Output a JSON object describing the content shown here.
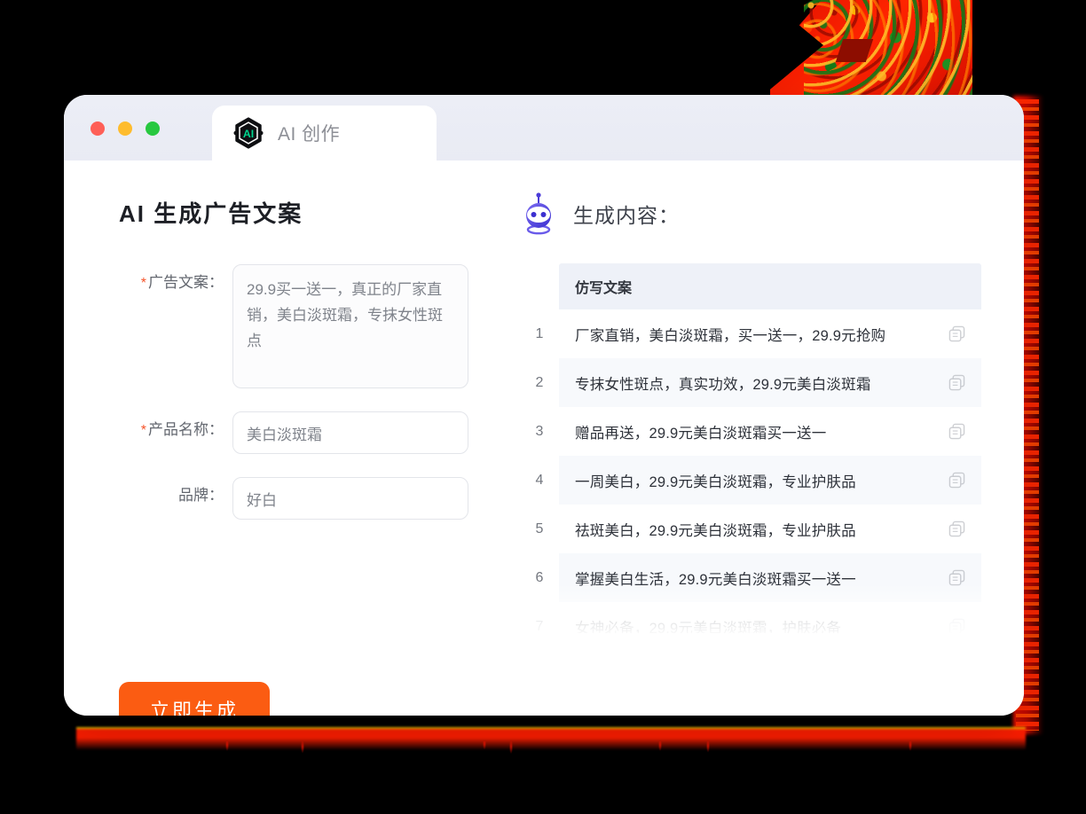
{
  "window": {
    "traffic_lights": [
      "close",
      "minimize",
      "maximize"
    ],
    "tab": {
      "label": "AI 创作",
      "logo_text": "AI",
      "logo_color": "#00d68f"
    }
  },
  "left_pane": {
    "title": "AI 生成广告文案",
    "fields": [
      {
        "label": "广告文案：",
        "required": true,
        "type": "textarea",
        "value": "29.9买一送一，真正的厂家直销，美白淡斑霜，专抹女性斑点"
      },
      {
        "label": "产品名称：",
        "required": true,
        "type": "input",
        "value": "美白淡斑霜"
      },
      {
        "label": "品牌：",
        "required": false,
        "type": "input",
        "value": "好白"
      }
    ],
    "submit_button": {
      "label": "立即生成",
      "color": "#fb5c12"
    }
  },
  "right_pane": {
    "title": "生成内容：",
    "robot_icon": "robot-head-icon",
    "table": {
      "column_header": "仿写文案",
      "rows": [
        {
          "index": "1",
          "text": "厂家直销，美白淡斑霜，买一送一，29.9元抢购",
          "action_icon": "copy-icon"
        },
        {
          "index": "2",
          "text": "专抹女性斑点，真实功效，29.9元美白淡斑霜",
          "action_icon": "copy-icon"
        },
        {
          "index": "3",
          "text": "赠品再送，29.9元美白淡斑霜买一送一",
          "action_icon": "copy-icon"
        },
        {
          "index": "4",
          "text": "一周美白，29.9元美白淡斑霜，专业护肤品",
          "action_icon": "copy-icon"
        },
        {
          "index": "5",
          "text": "祛斑美白，29.9元美白淡斑霜，专业护肤品",
          "action_icon": "copy-icon"
        },
        {
          "index": "6",
          "text": "掌握美白生活，29.9元美白淡斑霜买一送一",
          "action_icon": "copy-icon"
        },
        {
          "index": "7",
          "text": "女神必备，29.9元美白淡斑霜，护肤必备",
          "action_icon": "copy-icon"
        }
      ]
    }
  },
  "decoration": {
    "berry_graphic": "berry-texture-graphic",
    "glow_color": "#ff2400"
  }
}
